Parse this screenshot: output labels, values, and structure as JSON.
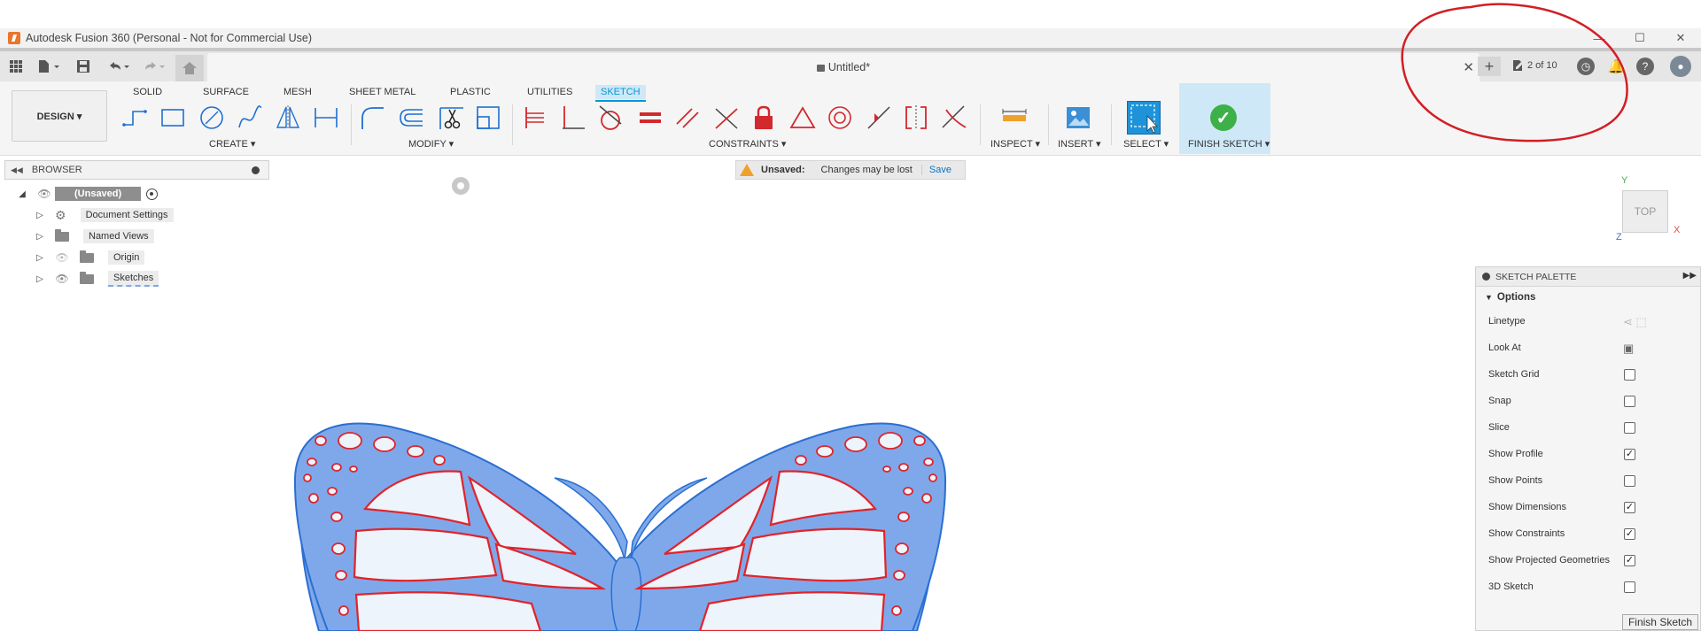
{
  "window": {
    "title": "Autodesk Fusion 360 (Personal - Not for Commercial Use)",
    "minimize": "—",
    "maximize": "☐",
    "close": "✕"
  },
  "document": {
    "tab_title": "Untitled*",
    "close_icon": "✕",
    "new_tab_icon": "+",
    "jobs_status": "2 of 10"
  },
  "ribbon": {
    "workspace": "DESIGN ▾",
    "tabs": [
      "SOLID",
      "SURFACE",
      "MESH",
      "SHEET METAL",
      "PLASTIC",
      "UTILITIES",
      "SKETCH"
    ],
    "active_tab": "SKETCH",
    "groups": {
      "create": "CREATE ▾",
      "modify": "MODIFY ▾",
      "constraints": "CONSTRAINTS ▾",
      "inspect": "INSPECT ▾",
      "insert": "INSERT ▾",
      "select": "SELECT ▾",
      "finish": "FINISH SKETCH ▾"
    }
  },
  "browser": {
    "title": "BROWSER",
    "root": "(Unsaved)",
    "items": [
      {
        "label": "Document Settings",
        "icon": "gear-icon"
      },
      {
        "label": "Named Views",
        "icon": "folder-icon"
      },
      {
        "label": "Origin",
        "icon": "folder-icon"
      },
      {
        "label": "Sketches",
        "icon": "folder-icon"
      }
    ]
  },
  "banner": {
    "title": "Unsaved:",
    "message": "Changes may be lost",
    "action": "Save"
  },
  "viewcube": {
    "face": "TOP",
    "x": "X",
    "y": "Y",
    "z": "Z"
  },
  "palette": {
    "title": "SKETCH PALETTE",
    "section": "Options",
    "rows": [
      {
        "label": "Linetype",
        "kind": "icon"
      },
      {
        "label": "Look At",
        "kind": "icon"
      },
      {
        "label": "Sketch Grid",
        "kind": "checkbox",
        "checked": false
      },
      {
        "label": "Snap",
        "kind": "checkbox",
        "checked": false
      },
      {
        "label": "Slice",
        "kind": "checkbox",
        "checked": false
      },
      {
        "label": "Show Profile",
        "kind": "checkbox",
        "checked": true
      },
      {
        "label": "Show Points",
        "kind": "checkbox",
        "checked": false
      },
      {
        "label": "Show Dimensions",
        "kind": "checkbox",
        "checked": true
      },
      {
        "label": "Show Constraints",
        "kind": "checkbox",
        "checked": true
      },
      {
        "label": "Show Projected Geometries",
        "kind": "checkbox",
        "checked": true
      },
      {
        "label": "3D Sketch",
        "kind": "checkbox",
        "checked": false
      }
    ],
    "finish_button": "Finish Sketch"
  },
  "colors": {
    "accent": "#0696d7",
    "profile_fill": "#7fa8ea",
    "sketch_line": "#e0242b",
    "annotation": "#d11f25"
  }
}
